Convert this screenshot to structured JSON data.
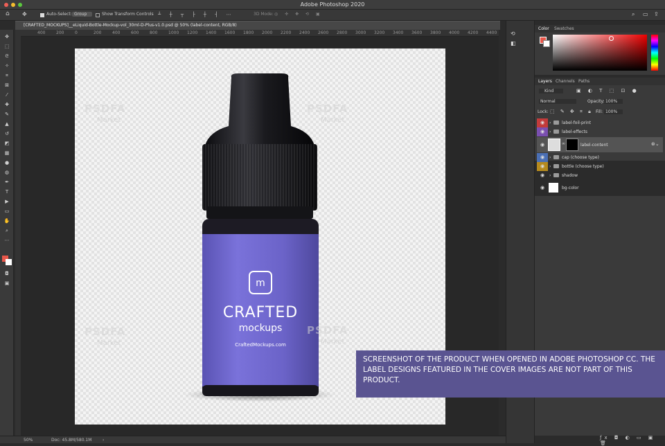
{
  "app_title": "Adobe Photoshop 2020",
  "options": {
    "auto_select_label": "Auto-Select:",
    "auto_select_value": "Group",
    "show_transform": "Show Transform Controls",
    "mode_3d": "3D Mode:"
  },
  "document": {
    "tab_title": "[CRAFTED_MOCKUPS]__eLiquid-Bottle-Mockup-vol_30ml-D-Plus-v1.0.psd @ 50% (label-content, RGB/8)",
    "zoom": "50%",
    "doc_info": "Doc: 45.8M/580.1M"
  },
  "ruler_ticks": [
    "400",
    "200",
    "0",
    "200",
    "400",
    "600",
    "800",
    "1000",
    "1200",
    "1400",
    "1600",
    "1800",
    "2000",
    "2200",
    "2400",
    "2600",
    "2800",
    "3000",
    "3200",
    "3400",
    "3600",
    "3800",
    "4000",
    "4200",
    "4400"
  ],
  "artwork": {
    "brand_line1": "CRAFTED",
    "brand_line2": "mockups",
    "website": "CraftedMockups.com",
    "watermark": "PSDFA",
    "watermark_sub": "Market"
  },
  "color_panel": {
    "tabs": [
      "Color",
      "Swatches"
    ],
    "foreground": "#e8574a",
    "background": "#ffffff"
  },
  "layers_panel": {
    "tabs": [
      "Layers",
      "Channels",
      "Paths"
    ],
    "kind": "Kind",
    "blend_mode": "Normal",
    "opacity_label": "Opacity:",
    "opacity_value": "100%",
    "lock_label": "Lock:",
    "fill_label": "Fill:",
    "fill_value": "100%",
    "layers": [
      {
        "name": "label-foil-print",
        "tag": "#c23b3b",
        "type": "folder"
      },
      {
        "name": "label-effects",
        "tag": "#7a4fb0",
        "type": "folder"
      },
      {
        "name": "label-content",
        "tag": "",
        "type": "smart",
        "selected": true
      },
      {
        "name": "cap (choose type)",
        "tag": "#4a6fb5",
        "type": "folder"
      },
      {
        "name": "bottle (choose type)",
        "tag": "#b58a1e",
        "type": "folder"
      },
      {
        "name": "shadow",
        "tag": "",
        "type": "folder"
      },
      {
        "name": "bg-color",
        "tag": "",
        "type": "fill"
      }
    ]
  },
  "caption": "SCREENSHOT OF THE PRODUCT WHEN OPENED IN ADOBE PHOTOSHOP CC. THE LABEL DESIGNS FEATURED IN THE COVER IMAGES ARE NOT PART OF THIS PRODUCT.",
  "colors": {
    "label": "#6c63c7",
    "cap": "#1b1b1f",
    "caption_bg": "#5a5491"
  }
}
